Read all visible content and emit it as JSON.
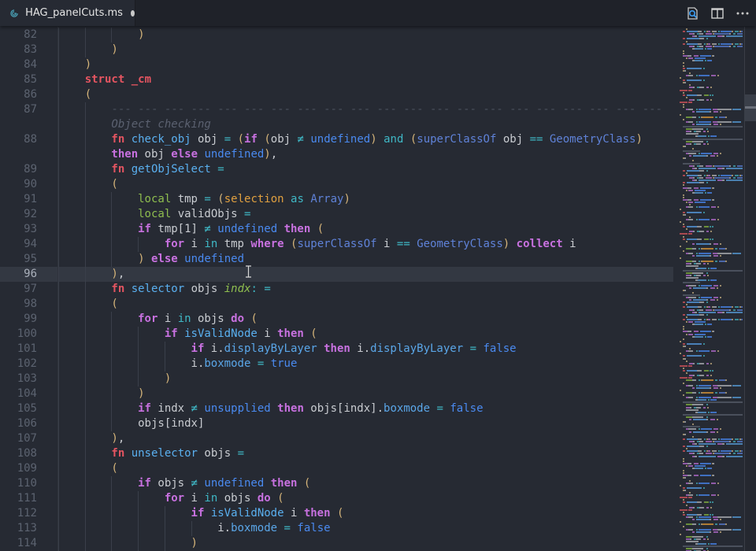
{
  "tab": {
    "title": "HAG_panelCuts.ms",
    "modified": true,
    "icon": "3dsmax-script-icon"
  },
  "toolbar": {
    "icons": [
      "search-file-icon",
      "split-editor-icon",
      "more-actions-icon"
    ]
  },
  "editor": {
    "current_line": "96",
    "lines": [
      {
        "num": "82",
        "ind": 3,
        "t": [
          [
            "p",
            ")"
          ]
        ]
      },
      {
        "num": "83",
        "ind": 2,
        "t": [
          [
            "p",
            ")"
          ]
        ]
      },
      {
        "num": "84",
        "ind": 1,
        "t": [
          [
            "p",
            ")"
          ]
        ]
      },
      {
        "num": "85",
        "ind": 1,
        "t": [
          [
            "red",
            "struct"
          ],
          [
            "id",
            " "
          ],
          [
            "red",
            "_cm"
          ]
        ]
      },
      {
        "num": "86",
        "ind": 1,
        "t": [
          [
            "p",
            "("
          ]
        ]
      },
      {
        "num": "87",
        "ind": 2,
        "t": [
          [
            "dash",
            "--- --- --- --- --- --- --- --- --- --- --- --- --- --- --- --- --- --- --- --- --- "
          ]
        ]
      },
      {
        "num": "",
        "ind": 2,
        "t": [
          [
            "cm",
            "Object checking"
          ]
        ]
      },
      {
        "num": "88",
        "ind": 2,
        "t": [
          [
            "red",
            "fn"
          ],
          [
            "id",
            " "
          ],
          [
            "fn",
            "check_obj"
          ],
          [
            "id",
            " obj "
          ],
          [
            "op",
            "="
          ],
          [
            "id",
            " "
          ],
          [
            "p",
            "("
          ],
          [
            "kw",
            "if"
          ],
          [
            "id",
            " "
          ],
          [
            "p",
            "("
          ],
          [
            "id",
            "obj "
          ],
          [
            "op",
            "≠"
          ],
          [
            "id",
            " "
          ],
          [
            "const",
            "undefined"
          ],
          [
            "p",
            ")"
          ],
          [
            "id",
            " "
          ],
          [
            "op",
            "and"
          ],
          [
            "id",
            " "
          ],
          [
            "p",
            "("
          ],
          [
            "bi",
            "superClassOf"
          ],
          [
            "id",
            " obj "
          ],
          [
            "op",
            "=="
          ],
          [
            "id",
            " "
          ],
          [
            "bi",
            "GeometryClass"
          ],
          [
            "p",
            ")"
          ]
        ]
      },
      {
        "num": "",
        "ind": 2,
        "t": [
          [
            "kw",
            "then"
          ],
          [
            "id",
            " obj "
          ],
          [
            "kw",
            "else"
          ],
          [
            "id",
            " "
          ],
          [
            "const",
            "undefined"
          ],
          [
            "p",
            ")"
          ],
          [
            "id",
            ","
          ]
        ]
      },
      {
        "num": "89",
        "ind": 2,
        "t": [
          [
            "red",
            "fn"
          ],
          [
            "id",
            " "
          ],
          [
            "fn",
            "getObjSelect"
          ],
          [
            "id",
            " "
          ],
          [
            "op",
            "="
          ]
        ]
      },
      {
        "num": "90",
        "ind": 2,
        "t": [
          [
            "p",
            "("
          ]
        ]
      },
      {
        "num": "91",
        "ind": 3,
        "t": [
          [
            "local",
            "local"
          ],
          [
            "id",
            " tmp "
          ],
          [
            "op",
            "="
          ],
          [
            "id",
            " "
          ],
          [
            "p",
            "("
          ],
          [
            "sel",
            "selection"
          ],
          [
            "id",
            " "
          ],
          [
            "op",
            "as"
          ],
          [
            "id",
            " "
          ],
          [
            "bi",
            "Array"
          ],
          [
            "p",
            ")"
          ]
        ]
      },
      {
        "num": "92",
        "ind": 3,
        "t": [
          [
            "local",
            "local"
          ],
          [
            "id",
            " validObjs "
          ],
          [
            "op",
            "="
          ]
        ]
      },
      {
        "num": "93",
        "ind": 3,
        "t": [
          [
            "kw",
            "if"
          ],
          [
            "id",
            " tmp[1] "
          ],
          [
            "op",
            "≠"
          ],
          [
            "id",
            " "
          ],
          [
            "const",
            "undefined"
          ],
          [
            "id",
            " "
          ],
          [
            "kw",
            "then"
          ],
          [
            "id",
            " "
          ],
          [
            "p",
            "("
          ]
        ]
      },
      {
        "num": "94",
        "ind": 4,
        "t": [
          [
            "kw",
            "for"
          ],
          [
            "id",
            " i "
          ],
          [
            "op",
            "in"
          ],
          [
            "id",
            " tmp "
          ],
          [
            "kw",
            "where"
          ],
          [
            "id",
            " "
          ],
          [
            "p",
            "("
          ],
          [
            "bi",
            "superClassOf"
          ],
          [
            "id",
            " i "
          ],
          [
            "op",
            "=="
          ],
          [
            "id",
            " "
          ],
          [
            "bi",
            "GeometryClass"
          ],
          [
            "p",
            ")"
          ],
          [
            "id",
            " "
          ],
          [
            "kw",
            "collect"
          ],
          [
            "id",
            " i"
          ]
        ]
      },
      {
        "num": "95",
        "ind": 3,
        "t": [
          [
            "p",
            ")"
          ],
          [
            "id",
            " "
          ],
          [
            "kw",
            "else"
          ],
          [
            "id",
            " "
          ],
          [
            "const",
            "undefined"
          ]
        ]
      },
      {
        "num": "96",
        "ind": 2,
        "t": [
          [
            "p",
            ")"
          ],
          [
            "id",
            ","
          ]
        ]
      },
      {
        "num": "97",
        "ind": 2,
        "t": [
          [
            "red",
            "fn"
          ],
          [
            "id",
            " "
          ],
          [
            "fn",
            "selector"
          ],
          [
            "id",
            " objs "
          ],
          [
            "arg",
            "indx"
          ],
          [
            "op",
            ":"
          ],
          [
            "id",
            " "
          ],
          [
            "op",
            "="
          ]
        ]
      },
      {
        "num": "98",
        "ind": 2,
        "t": [
          [
            "p",
            "("
          ]
        ]
      },
      {
        "num": "99",
        "ind": 3,
        "t": [
          [
            "kw",
            "for"
          ],
          [
            "id",
            " i "
          ],
          [
            "op",
            "in"
          ],
          [
            "id",
            " objs "
          ],
          [
            "kw",
            "do"
          ],
          [
            "id",
            " "
          ],
          [
            "p",
            "("
          ]
        ]
      },
      {
        "num": "100",
        "ind": 4,
        "t": [
          [
            "kw",
            "if"
          ],
          [
            "id",
            " "
          ],
          [
            "fn",
            "isValidNode"
          ],
          [
            "id",
            " i "
          ],
          [
            "kw",
            "then"
          ],
          [
            "id",
            " "
          ],
          [
            "p",
            "("
          ]
        ]
      },
      {
        "num": "101",
        "ind": 5,
        "t": [
          [
            "kw",
            "if"
          ],
          [
            "id",
            " i."
          ],
          [
            "prop",
            "displayByLayer"
          ],
          [
            "id",
            " "
          ],
          [
            "kw",
            "then"
          ],
          [
            "id",
            " i."
          ],
          [
            "prop",
            "displayByLayer"
          ],
          [
            "id",
            " "
          ],
          [
            "op",
            "="
          ],
          [
            "id",
            " "
          ],
          [
            "const",
            "false"
          ]
        ]
      },
      {
        "num": "102",
        "ind": 5,
        "t": [
          [
            "id",
            "i."
          ],
          [
            "prop",
            "boxmode"
          ],
          [
            "id",
            " "
          ],
          [
            "op",
            "="
          ],
          [
            "id",
            " "
          ],
          [
            "const",
            "true"
          ]
        ]
      },
      {
        "num": "103",
        "ind": 4,
        "t": [
          [
            "p",
            ")"
          ]
        ]
      },
      {
        "num": "104",
        "ind": 3,
        "t": [
          [
            "p",
            ")"
          ]
        ]
      },
      {
        "num": "105",
        "ind": 3,
        "t": [
          [
            "kw",
            "if"
          ],
          [
            "id",
            " indx "
          ],
          [
            "op",
            "≠"
          ],
          [
            "id",
            " "
          ],
          [
            "const",
            "unsupplied"
          ],
          [
            "id",
            " "
          ],
          [
            "kw",
            "then"
          ],
          [
            "id",
            " objs[indx]."
          ],
          [
            "prop",
            "boxmode"
          ],
          [
            "id",
            " "
          ],
          [
            "op",
            "="
          ],
          [
            "id",
            " "
          ],
          [
            "const",
            "false"
          ]
        ]
      },
      {
        "num": "106",
        "ind": 3,
        "t": [
          [
            "id",
            "objs[indx]"
          ]
        ]
      },
      {
        "num": "107",
        "ind": 2,
        "t": [
          [
            "p",
            ")"
          ],
          [
            "id",
            ","
          ]
        ]
      },
      {
        "num": "108",
        "ind": 2,
        "t": [
          [
            "red",
            "fn"
          ],
          [
            "id",
            " "
          ],
          [
            "fn",
            "unselector"
          ],
          [
            "id",
            " objs "
          ],
          [
            "op",
            "="
          ]
        ]
      },
      {
        "num": "109",
        "ind": 2,
        "t": [
          [
            "p",
            "("
          ]
        ]
      },
      {
        "num": "110",
        "ind": 3,
        "t": [
          [
            "kw",
            "if"
          ],
          [
            "id",
            " objs "
          ],
          [
            "op",
            "≠"
          ],
          [
            "id",
            " "
          ],
          [
            "const",
            "undefined"
          ],
          [
            "id",
            " "
          ],
          [
            "kw",
            "then"
          ],
          [
            "id",
            " "
          ],
          [
            "p",
            "("
          ]
        ]
      },
      {
        "num": "111",
        "ind": 4,
        "t": [
          [
            "kw",
            "for"
          ],
          [
            "id",
            " i "
          ],
          [
            "op",
            "in"
          ],
          [
            "id",
            " objs "
          ],
          [
            "kw",
            "do"
          ],
          [
            "id",
            " "
          ],
          [
            "p",
            "("
          ]
        ]
      },
      {
        "num": "112",
        "ind": 5,
        "t": [
          [
            "kw",
            "if"
          ],
          [
            "id",
            " "
          ],
          [
            "fn",
            "isValidNode"
          ],
          [
            "id",
            " i "
          ],
          [
            "kw",
            "then"
          ],
          [
            "id",
            " "
          ],
          [
            "p",
            "("
          ]
        ]
      },
      {
        "num": "113",
        "ind": 6,
        "t": [
          [
            "id",
            "i."
          ],
          [
            "prop",
            "boxmode"
          ],
          [
            "id",
            " "
          ],
          [
            "op",
            "="
          ],
          [
            "id",
            " "
          ],
          [
            "const",
            "false"
          ]
        ]
      },
      {
        "num": "114",
        "ind": 5,
        "t": [
          [
            "p",
            ")"
          ]
        ]
      }
    ]
  },
  "colors": {
    "background": "#262a33",
    "tabbar": "#1f2229",
    "current_line": "#333842"
  }
}
